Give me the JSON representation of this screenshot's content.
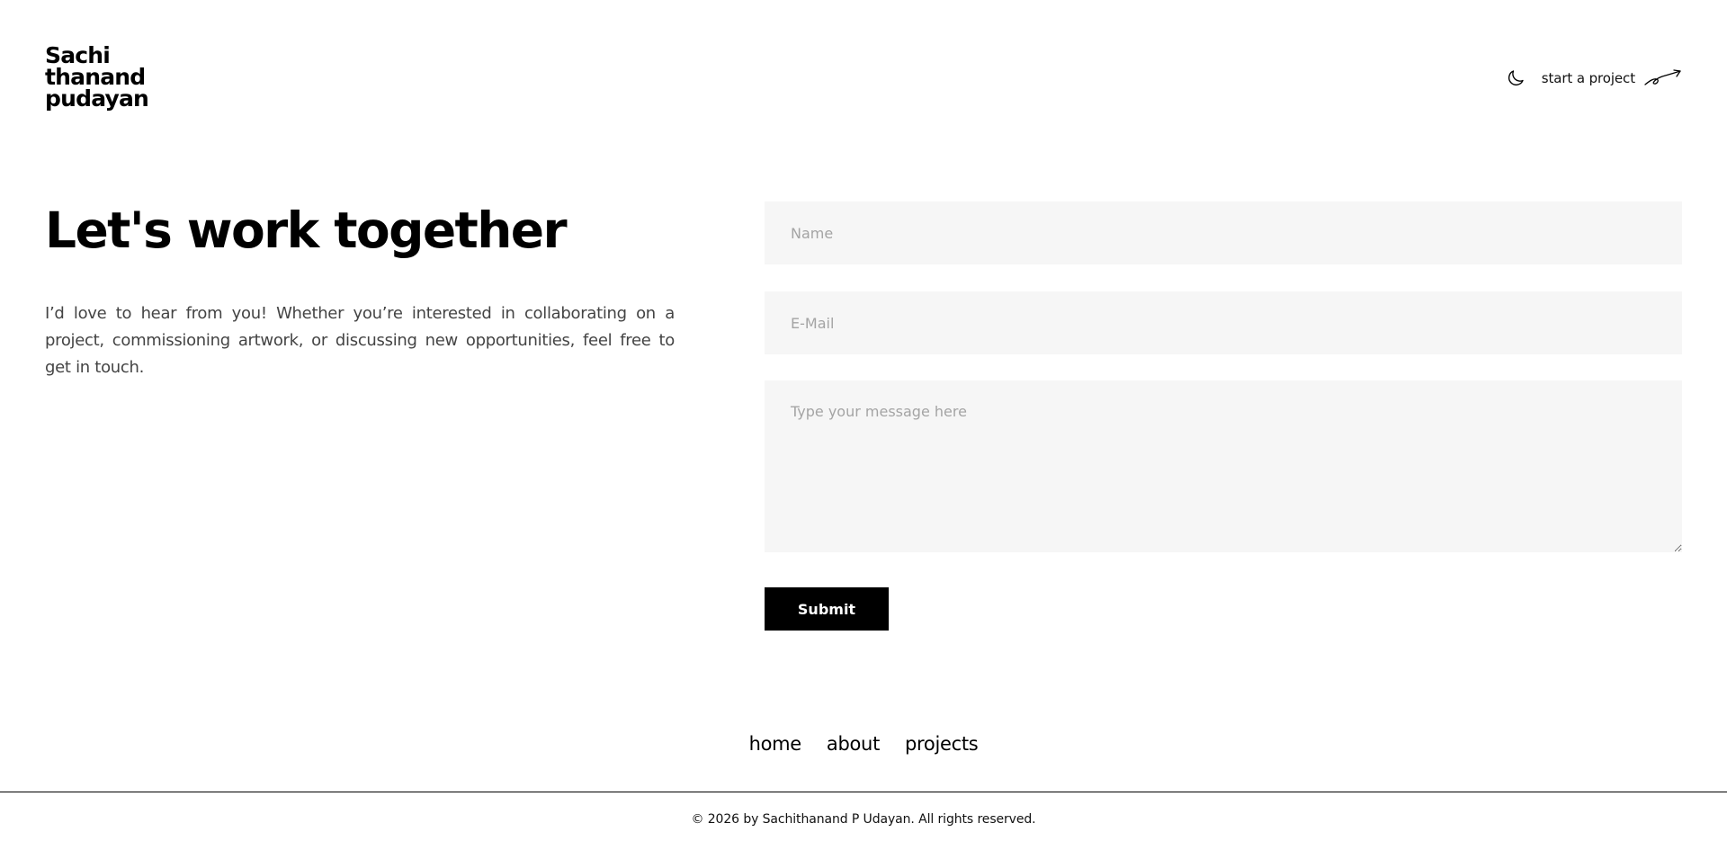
{
  "header": {
    "logo_lines": [
      "Sachi",
      "thanand",
      "pudayan"
    ],
    "theme_toggle_icon": "moon-icon",
    "cta_label": "start a project",
    "cta_icon": "curved-arrow-icon"
  },
  "main": {
    "heading": "Let's work together",
    "intro": "I’d love to hear from you! Whether you’re interested in collaborating on a project, commissioning artwork, or discussing new opportunities, feel free to get in touch."
  },
  "form": {
    "name_placeholder": "Name",
    "name_value": "",
    "email_placeholder": "E-Mail",
    "email_value": "",
    "message_placeholder": "Type your message here",
    "message_value": "",
    "submit_label": "Submit"
  },
  "footer": {
    "nav": [
      "home",
      "about",
      "projects"
    ],
    "copyright": "© 2026 by Sachithanand P Udayan. All rights reserved."
  },
  "colors": {
    "background": "#ffffff",
    "text": "#000000",
    "field_background": "#f6f6f6",
    "placeholder": "#a4a4a4",
    "button_background": "#000000",
    "button_text": "#ffffff"
  }
}
